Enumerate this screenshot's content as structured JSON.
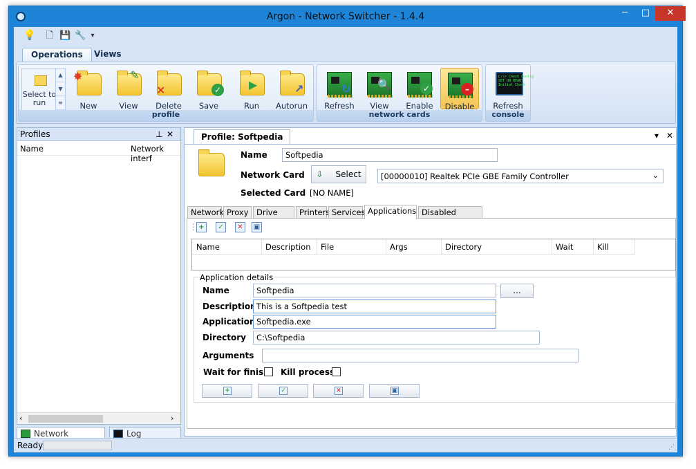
{
  "window": {
    "title": "Argon - Network Switcher - 1.4.4",
    "min": "─",
    "max": "□",
    "close": "✕"
  },
  "quick_access": {
    "bulb": "💡",
    "new": "🗋",
    "save": "💾",
    "tool": "🔧",
    "dropdown": "▾"
  },
  "ribbon_tabs": [
    "Operations",
    "Views"
  ],
  "ribbon": {
    "select_to_run": "Select to run",
    "profile_group": {
      "label": "profile",
      "buttons": [
        "New",
        "View",
        "Delete",
        "Save",
        "Run",
        "Autorun"
      ]
    },
    "cards_group": {
      "label": "network cards",
      "buttons": [
        "Refresh",
        "View",
        "Enable",
        "Disable"
      ]
    },
    "console_group": {
      "label": "console",
      "buttons": [
        "Refresh"
      ]
    },
    "console_screen": "C:\\> Check Config\nSET ON READY\nInitial Check"
  },
  "profiles_pane": {
    "title": "Profiles",
    "pin": "⊥",
    "close": "✕",
    "columns": [
      "Name",
      "Network interf"
    ]
  },
  "bottom_tabs": [
    "Network Adapters",
    "Log Console"
  ],
  "status": {
    "text": "Ready"
  },
  "profile": {
    "tab_title": "Profile: Softpedia",
    "tab_ctrl_down": "▾",
    "tab_ctrl_close": "✕",
    "name_label": "Name",
    "name_value": "Softpedia",
    "network_card_label": "Network Card",
    "select_button": "Select",
    "select_icon": "⇩",
    "network_card_value": "[00000010] Realtek PCIe GBE Family Controller",
    "selected_card_label": "Selected Card",
    "selected_card_value": "[NO NAME]"
  },
  "profile_tabs": [
    "Network",
    "Proxy",
    "Drive Map",
    "Printers",
    "Services",
    "Applications",
    "Disabled Adapters"
  ],
  "apps": {
    "columns": [
      "Name",
      "Description",
      "File",
      "Args",
      "Directory",
      "Wait",
      "Kill"
    ],
    "toolbar_icons": [
      "+",
      "✓",
      "✕",
      "▣"
    ],
    "details_legend": "Application details",
    "name_label": "Name",
    "name_value": "Softpedia",
    "browse_button": "...",
    "description_label": "Description",
    "description_value": "This is a Softpedia test",
    "application_label": "Application",
    "application_value": "Softpedia.exe",
    "directory_label": "Directory",
    "directory_value": "C:\\Softpedia",
    "arguments_label": "Arguments",
    "arguments_value": "",
    "wait_label": "Wait for finish",
    "kill_label": "Kill process"
  },
  "colors": {
    "title_bar": "#1e84d8",
    "ribbon": "#d3e2f4",
    "accent_pressed": "#f5c552"
  }
}
